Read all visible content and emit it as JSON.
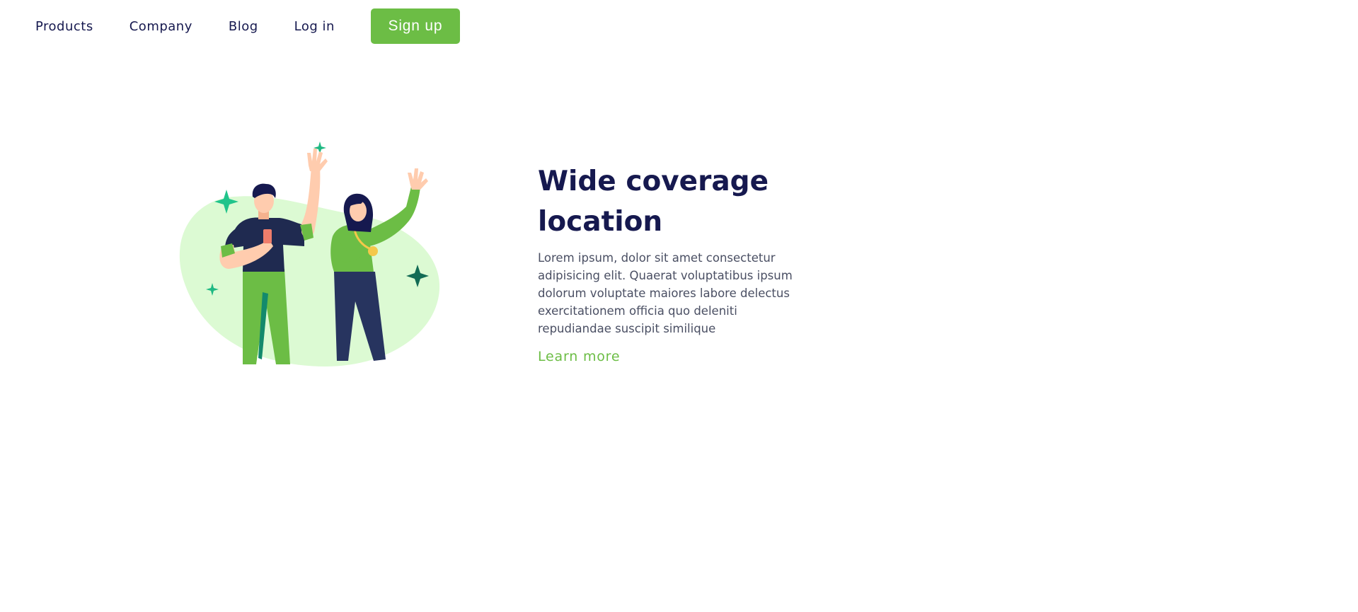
{
  "nav": {
    "items": [
      {
        "label": "Products"
      },
      {
        "label": "Company"
      },
      {
        "label": "Blog"
      },
      {
        "label": "Log in"
      }
    ],
    "signup_label": "Sign up"
  },
  "feature": {
    "title_line1": "Wide coverage",
    "title_line2": "location",
    "description": "Lorem ipsum, dolor sit amet consectetur adipisicing elit. Quaerat voluptatibus ipsum dolorum voluptate maiores labore delectus exercitationem officia quo deleniti repudiandae suscipit similique",
    "link_label": "Learn more"
  },
  "colors": {
    "accent": "#6cbd45",
    "heading": "#16194f",
    "body_text": "#4a4f63",
    "blob": "#dcfad3"
  }
}
